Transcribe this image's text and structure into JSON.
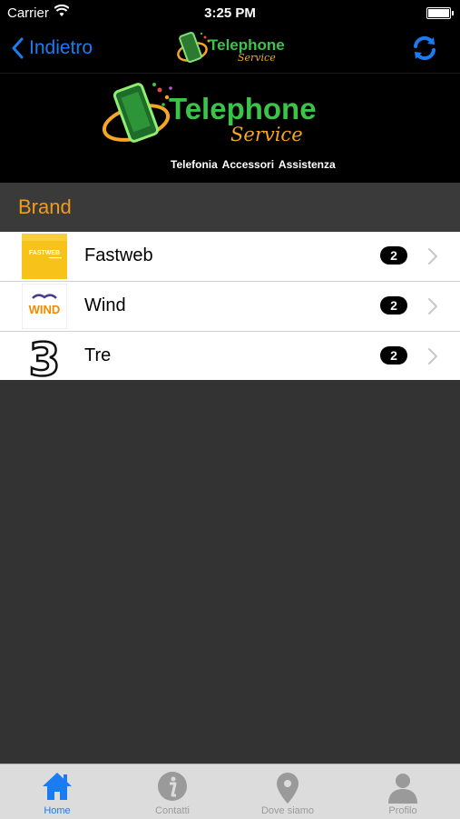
{
  "status_bar": {
    "carrier": "Carrier",
    "time": "3:25 PM"
  },
  "nav": {
    "back_label": "Indietro",
    "logo_text": "Telephone",
    "logo_script": "Service"
  },
  "banner": {
    "logo_text": "Telephone",
    "logo_script": "Service",
    "tagline": "Telefonia  Accessori  Assistenza"
  },
  "section": {
    "title": "Brand"
  },
  "brands": [
    {
      "label": "Fastweb",
      "count": "2",
      "logo_text": "FASTWEB"
    },
    {
      "label": "Wind",
      "count": "2",
      "logo_text": "WIND"
    },
    {
      "label": "Tre",
      "count": "2",
      "logo_text": "3"
    }
  ],
  "tabs": [
    {
      "label": "Home",
      "icon": "home-icon",
      "active": true
    },
    {
      "label": "Contatti",
      "icon": "info-icon",
      "active": false
    },
    {
      "label": "Dove siamo",
      "icon": "map-pin-icon",
      "active": false
    },
    {
      "label": "Profilo",
      "icon": "person-icon",
      "active": false
    }
  ],
  "colors": {
    "accent": "#1a7cf0",
    "section_title": "#f39a1b",
    "logo_green": "#3cc34a",
    "logo_orange": "#f5a623"
  }
}
